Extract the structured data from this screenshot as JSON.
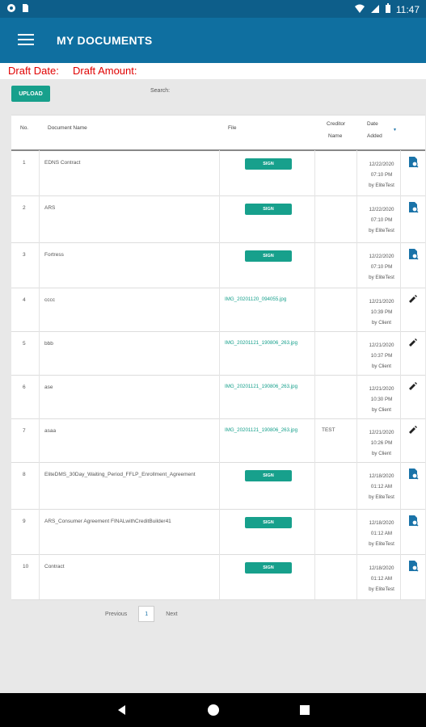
{
  "status_bar": {
    "time": "11:47",
    "icons": [
      "circle-icon",
      "sim-icon",
      "wifi-icon",
      "signal-icon",
      "battery-icon"
    ]
  },
  "app_bar": {
    "title": "MY DOCUMENTS"
  },
  "draft": {
    "date_label": "Draft Date:",
    "amount_label": "Draft Amount:"
  },
  "toolbar": {
    "upload_label": "UPLOAD",
    "search_label": "Search:"
  },
  "table": {
    "headers": {
      "no": "No.",
      "doc": "Document Name",
      "file": "File",
      "creditor1": "Creditor",
      "creditor2": "Name",
      "date1": "Date",
      "date2": "Added",
      "sort": "▼"
    },
    "rows": [
      {
        "no": "1",
        "doc": "EDNS Contract",
        "file": "",
        "sign": "SIGN",
        "creditor": "",
        "date1": "12/22/2020",
        "date2": "07:10 PM",
        "date3": "by EliteTest",
        "action": "doc-icon"
      },
      {
        "no": "2",
        "doc": "ARS",
        "file": "",
        "sign": "SIGN",
        "creditor": "",
        "date1": "12/22/2020",
        "date2": "07:10 PM",
        "date3": "by EliteTest",
        "action": "doc-icon"
      },
      {
        "no": "3",
        "doc": "Fortress",
        "file": "",
        "sign": "SIGN",
        "creditor": "",
        "date1": "12/22/2020",
        "date2": "07:10 PM",
        "date3": "by EliteTest",
        "action": "doc-icon"
      },
      {
        "no": "4",
        "doc": "cccc",
        "file": "IMG_20201120_094055.jpg",
        "sign": "",
        "creditor": "",
        "date1": "12/21/2020",
        "date2": "10:39 PM",
        "date3": "by Client",
        "action": "pencil-icon"
      },
      {
        "no": "5",
        "doc": "bbb",
        "file": "IMG_20201121_190806_263.jpg",
        "sign": "",
        "creditor": "",
        "date1": "12/21/2020",
        "date2": "10:37 PM",
        "date3": "by Client",
        "action": "pencil-icon"
      },
      {
        "no": "6",
        "doc": "ase",
        "file": "IMG_20201121_190806_263.jpg",
        "sign": "",
        "creditor": "",
        "date1": "12/21/2020",
        "date2": "10:30 PM",
        "date3": "by Client",
        "action": "pencil-icon"
      },
      {
        "no": "7",
        "doc": "asaa",
        "file": "IMG_20201121_190806_263.jpg",
        "sign": "",
        "creditor": "TEST",
        "date1": "12/21/2020",
        "date2": "10:26 PM",
        "date3": "by Client",
        "action": "pencil-icon"
      },
      {
        "no": "8",
        "doc": "EliteDMS_30Day_Waiting_Period_FFLP_Enrollment_Agreement",
        "file": "",
        "sign": "SIGN",
        "creditor": "",
        "date1": "12/18/2020",
        "date2": "01:12 AM",
        "date3": "by EliteTest",
        "action": "doc-icon"
      },
      {
        "no": "9",
        "doc": "ARS_Consumer Agreement FINALwithCreditBuilder41",
        "file": "",
        "sign": "SIGN",
        "creditor": "",
        "date1": "12/18/2020",
        "date2": "01:12 AM",
        "date3": "by EliteTest",
        "action": "doc-icon"
      },
      {
        "no": "10",
        "doc": "Contract",
        "file": "",
        "sign": "SIGN",
        "creditor": "",
        "date1": "12/18/2020",
        "date2": "01:12 AM",
        "date3": "by EliteTest",
        "action": "doc-icon"
      }
    ]
  },
  "pagination": {
    "previous": "Previous",
    "page": "1",
    "next": "Next"
  },
  "nav_bar": {
    "buttons": [
      "back-icon",
      "home-icon",
      "recents-icon"
    ]
  },
  "colors": {
    "app_bar": "#0f6fa0",
    "status_bar": "#0d5e8a",
    "accent": "#17a08c",
    "draft_text": "#e00000"
  }
}
